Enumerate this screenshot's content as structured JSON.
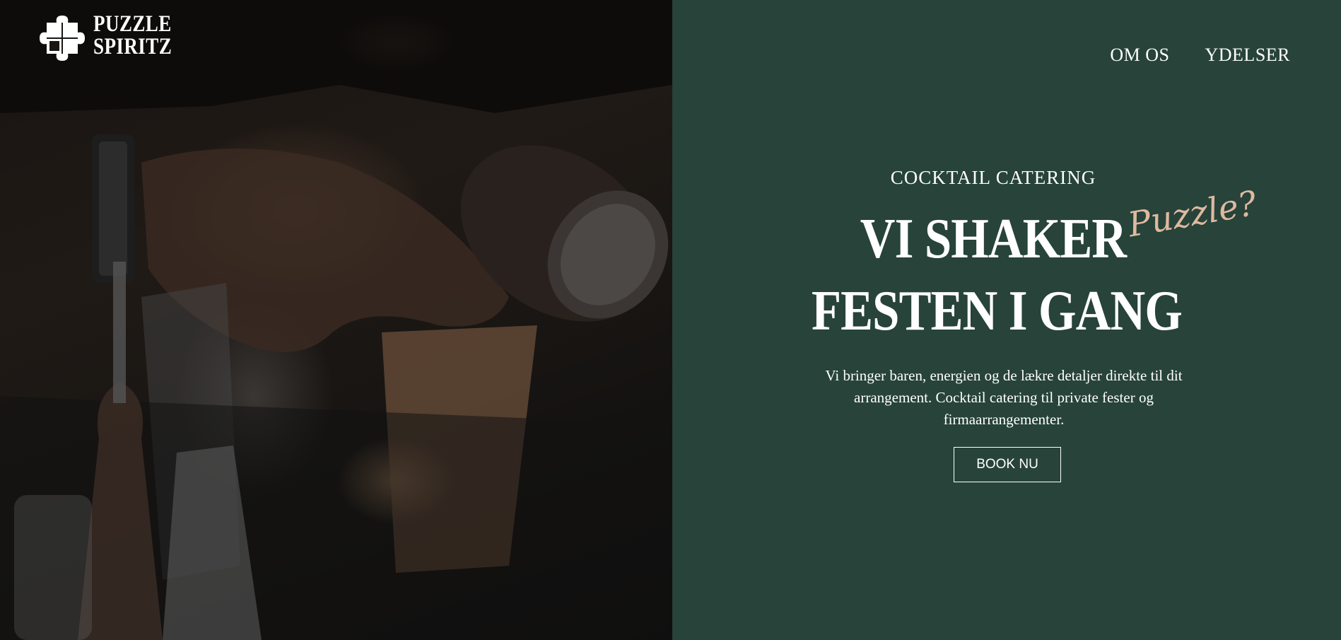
{
  "logo": {
    "line1": "PUZZLE",
    "line2": "SPIRITZ"
  },
  "nav": {
    "items": [
      "OM OS",
      "YDELSER"
    ]
  },
  "hero": {
    "eyebrow": "COCKTAIL CATERING",
    "headline_line1": "VI SHAKER",
    "headline_line2": "FESTEN I GANG",
    "script_text": "Puzzle?",
    "description": "Vi bringer baren, energien og de lækre detaljer direkte til dit arrangement. Cocktail catering til private fester og firmaarrangementer.",
    "cta_label": "BOOK NU"
  },
  "colors": {
    "panel_bg": "#27433a",
    "accent_script": "#ddb9a0",
    "text": "#ffffff"
  }
}
